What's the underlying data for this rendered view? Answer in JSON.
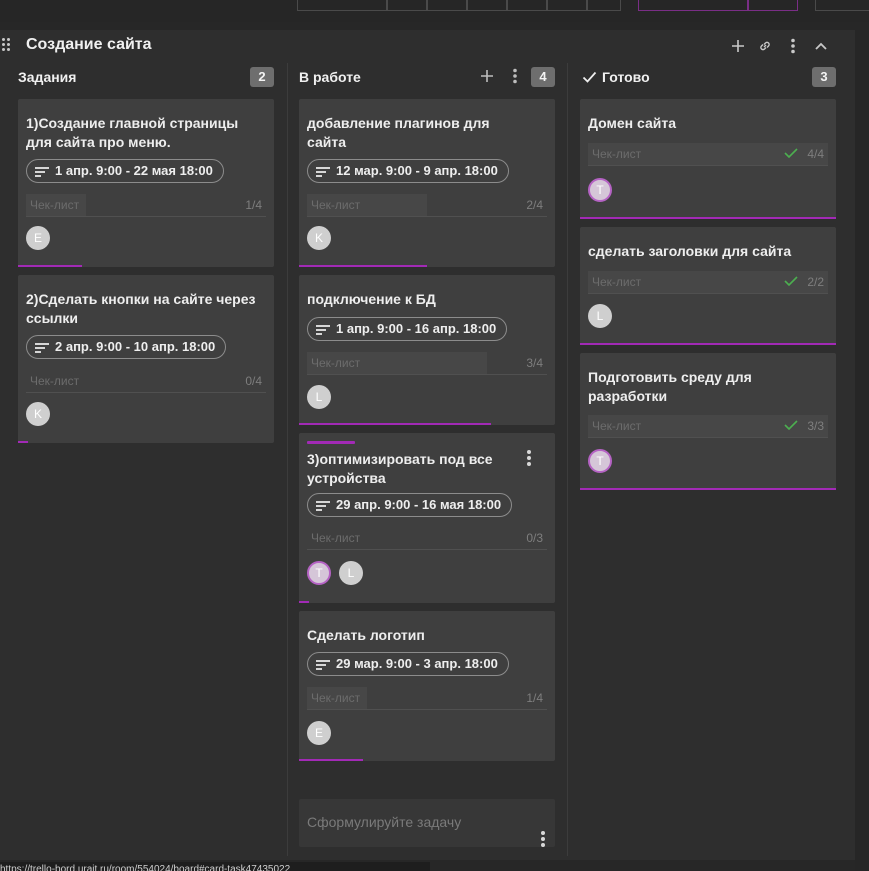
{
  "board": {
    "title": "Создание сайта"
  },
  "columns": [
    {
      "title": "Задания",
      "count": "2"
    },
    {
      "title": "В работе",
      "count": "4"
    },
    {
      "title": "Готово",
      "count": "3"
    }
  ],
  "checklist_label": "Чек-лист",
  "cards": {
    "c1": {
      "title": "1)Создание главной страницы для сайта про меню.",
      "date": "1 апр. 9:00 - 22 мая 18:00",
      "checklist": "1/4",
      "avatars": [
        "E"
      ],
      "progress": 0.25
    },
    "c2": {
      "title": "2)Сделать кнопки на сайте через ссылки",
      "date": "2 апр. 9:00 - 10 апр. 18:00",
      "checklist": "0/4",
      "avatars": [
        "K"
      ],
      "progress": 0.0
    },
    "c3": {
      "title": "добавление плагинов для сайта",
      "date": "12 мар. 9:00 - 9 апр. 18:00",
      "checklist": "2/4",
      "avatars": [
        "K"
      ],
      "progress": 0.5
    },
    "c4": {
      "title": "подключение к БД",
      "date": "1 апр. 9:00 - 16 апр. 18:00",
      "checklist": "3/4",
      "avatars": [
        "L"
      ],
      "progress": 0.75
    },
    "c5": {
      "title": "3)оптимизировать под все устройства",
      "date": "29 апр. 9:00 - 16 мая 18:00",
      "checklist": "0/3",
      "avatars": [
        "T",
        "L"
      ],
      "progress": 0.0
    },
    "c6": {
      "title": "Сделать логотип",
      "date": "29 мар. 9:00 - 3 апр. 18:00",
      "checklist": "1/4",
      "avatars": [
        "E"
      ],
      "progress": 0.25
    },
    "c7": {
      "title": "Домен сайта",
      "checklist": "4/4",
      "avatars": [
        "T"
      ],
      "progress": 1.0
    },
    "c8": {
      "title": "сделать заголовки для сайта",
      "checklist": "2/2",
      "avatars": [
        "L"
      ],
      "progress": 1.0
    },
    "c9": {
      "title": "Подготовить среду для разработки",
      "checklist": "3/3",
      "avatars": [
        "T"
      ],
      "progress": 1.0
    }
  },
  "new_task": {
    "placeholder": "Сформулируйте задачу"
  },
  "statusbar": {
    "url": "https://trello-bord.urait.ru/room/554024/board#card-task47435022"
  },
  "icons": [
    "drag-handle-icon",
    "plus-icon",
    "link-icon",
    "kebab-icon",
    "chevron-up-icon",
    "check-icon",
    "date-range-icon"
  ],
  "colors": {
    "accent": "#a22ab6",
    "card": "#3f3f3f",
    "board": "#2e2e2e",
    "done_check": "#4caf50"
  }
}
